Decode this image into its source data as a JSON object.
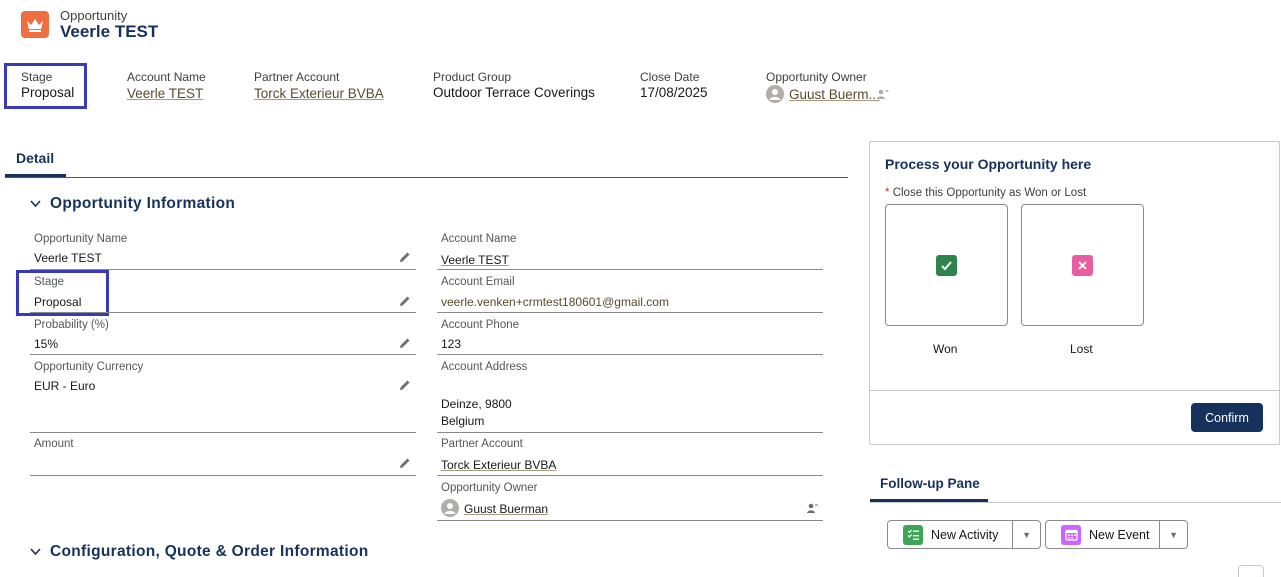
{
  "header": {
    "object_type": "Opportunity",
    "record_name": "Veerle TEST",
    "icon": "crown-icon"
  },
  "highlights": [
    {
      "label": "Stage",
      "value": "Proposal"
    },
    {
      "label": "Account Name",
      "value": "Veerle TEST"
    },
    {
      "label": "Partner Account",
      "value": "Torck Exterieur BVBA"
    },
    {
      "label": "Product Group",
      "value": "Outdoor Terrace Coverings"
    },
    {
      "label": "Close Date",
      "value": "17/08/2025"
    },
    {
      "label": "Opportunity Owner",
      "value": "Guust Buerm..."
    }
  ],
  "tabs": {
    "detail": "Detail"
  },
  "sections": {
    "opp_info": "Opportunity Information",
    "config": "Configuration, Quote & Order Information"
  },
  "left_fields": [
    {
      "label": "Opportunity Name",
      "value": "Veerle TEST"
    },
    {
      "label": "Stage",
      "value": "Proposal"
    },
    {
      "label": "Probability (%)",
      "value": "15%"
    },
    {
      "label": "Opportunity Currency",
      "value": "EUR - Euro"
    },
    {
      "label": "Amount",
      "value": ""
    }
  ],
  "right_fields": {
    "account_name": {
      "label": "Account Name",
      "value": "Veerle TEST"
    },
    "account_email": {
      "label": "Account Email",
      "value": "veerle.venken+crmtest180601@gmail.com"
    },
    "account_phone": {
      "label": "Account Phone",
      "value": "123"
    },
    "account_address": {
      "label": "Account Address",
      "line1": "Deinze, 9800",
      "line2": "Belgium"
    },
    "partner_account": {
      "label": "Partner Account",
      "value": "Torck Exterieur BVBA"
    },
    "opportunity_owner": {
      "label": "Opportunity Owner",
      "value": "Guust Buerman"
    }
  },
  "process_card": {
    "title": "Process your Opportunity here",
    "required_label": "Close this Opportunity as Won or Lost",
    "required_mark": "*",
    "won": "Won",
    "lost": "Lost",
    "confirm": "Confirm",
    "won_color": "#2e844a",
    "lost_color": "#e85ea3"
  },
  "followup": {
    "tab": "Follow-up Pane",
    "new_activity": "New Activity",
    "new_event": "New Event"
  },
  "colors": {
    "brand": "#16325c",
    "focus_outline": "#3a3ab8",
    "object_icon": "#ef6e40"
  }
}
